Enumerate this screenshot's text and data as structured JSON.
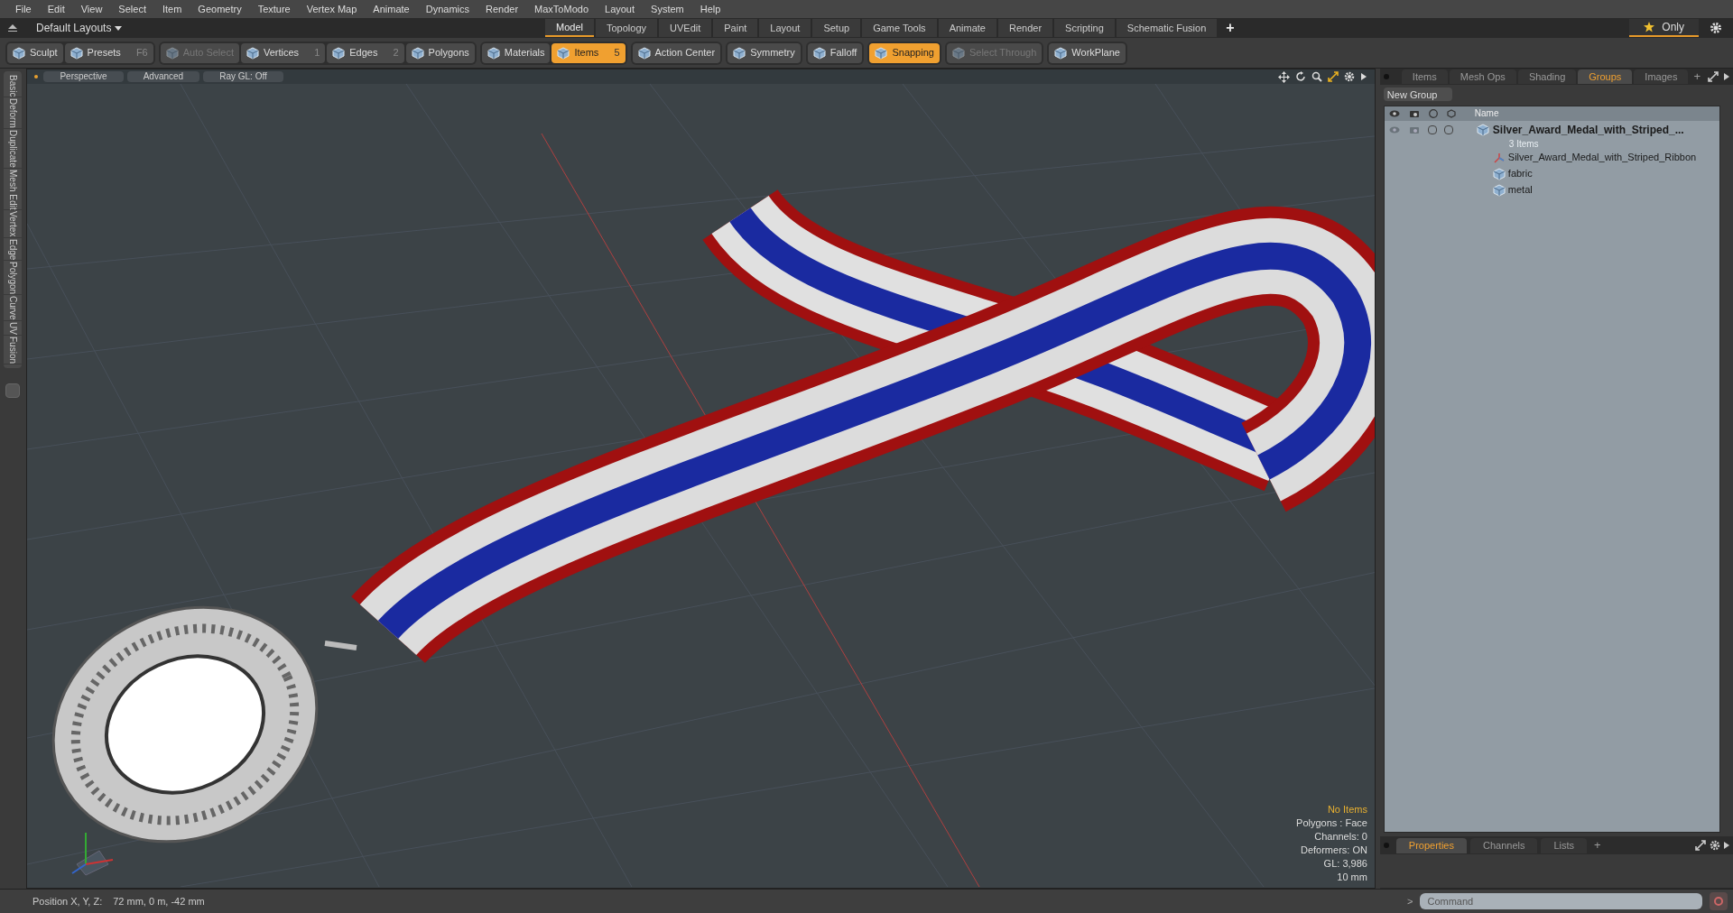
{
  "menu_bar": [
    "File",
    "Edit",
    "View",
    "Select",
    "Item",
    "Geometry",
    "Texture",
    "Vertex Map",
    "Animate",
    "Dynamics",
    "Render",
    "MaxToModo",
    "Layout",
    "System",
    "Help"
  ],
  "layout_selector": {
    "label": "Default Layouts"
  },
  "layout_tabs": [
    {
      "label": "Model",
      "selected": true
    },
    {
      "label": "Topology",
      "selected": false
    },
    {
      "label": "UVEdit",
      "selected": false
    },
    {
      "label": "Paint",
      "selected": false
    },
    {
      "label": "Layout",
      "selected": false
    },
    {
      "label": "Setup",
      "selected": false
    },
    {
      "label": "Game Tools",
      "selected": false
    },
    {
      "label": "Animate",
      "selected": false
    },
    {
      "label": "Render",
      "selected": false
    },
    {
      "label": "Scripting",
      "selected": false
    },
    {
      "label": "Schematic Fusion",
      "selected": false
    }
  ],
  "add_tab": {
    "label": "+"
  },
  "only_button": {
    "label": "Only"
  },
  "toolbar": [
    [
      {
        "label": "Sculpt",
        "selected": false,
        "disabled": false
      },
      {
        "label": "Presets",
        "shortcut": "F6",
        "selected": false,
        "disabled": false
      }
    ],
    [
      {
        "label": "Auto Select",
        "selected": false,
        "disabled": true
      },
      {
        "label": "Vertices",
        "shortcut": "1",
        "selected": false,
        "disabled": false
      },
      {
        "label": "Edges",
        "shortcut": "2",
        "selected": false,
        "disabled": false
      },
      {
        "label": "Polygons",
        "selected": false,
        "disabled": false
      }
    ],
    [
      {
        "label": "Materials",
        "selected": false,
        "disabled": false
      },
      {
        "label": "Items",
        "shortcut": "5",
        "selected": true,
        "disabled": false
      }
    ],
    [
      {
        "label": "Action Center",
        "selected": false,
        "disabled": false
      }
    ],
    [
      {
        "label": "Symmetry",
        "selected": false,
        "disabled": false
      }
    ],
    [
      {
        "label": "Falloff",
        "selected": false,
        "disabled": false
      }
    ],
    [
      {
        "label": "Snapping",
        "selected": true,
        "disabled": false
      }
    ],
    [
      {
        "label": "Select Through",
        "selected": false,
        "disabled": true
      }
    ],
    [
      {
        "label": "WorkPlane",
        "selected": false,
        "disabled": false
      }
    ]
  ],
  "side_tabs": [
    "Basic",
    "Deform",
    "Duplicate",
    "Mesh Edit",
    "Vertex",
    "Edge",
    "Polygon",
    "Curve",
    "UV",
    "Fusion"
  ],
  "viewport": {
    "header": [
      "Perspective",
      "Advanced",
      "Ray GL: Off"
    ],
    "info": [
      {
        "text": "No Items",
        "highlight": true
      },
      {
        "text": "Polygons : Face",
        "highlight": false
      },
      {
        "text": "Channels: 0",
        "highlight": false
      },
      {
        "text": "Deformers: ON",
        "highlight": false
      },
      {
        "text": "GL: 3,986",
        "highlight": false
      },
      {
        "text": "10 mm",
        "highlight": false
      }
    ]
  },
  "panel_tabs": [
    {
      "label": "Items",
      "selected": false
    },
    {
      "label": "Mesh Ops",
      "selected": false
    },
    {
      "label": "Shading",
      "selected": false
    },
    {
      "label": "Groups",
      "selected": true
    },
    {
      "label": "Images",
      "selected": false
    }
  ],
  "panel_add_tab": {
    "label": "+"
  },
  "new_group_button": {
    "label": "New Group"
  },
  "tree_header": {
    "name": "Name"
  },
  "tree": [
    {
      "label": "Silver_Award_Medal_with_Striped_...",
      "subtitle": "3 Items",
      "checks": [
        {
          "checked": false
        },
        {
          "checked": false
        }
      ],
      "children": [
        {
          "label": "Silver_Award_Medal_with_Striped_Ribbon",
          "kind": "locator"
        },
        {
          "label": "fabric",
          "kind": "mesh"
        },
        {
          "label": "metal",
          "kind": "mesh"
        }
      ]
    }
  ],
  "bottom_tabs": [
    {
      "label": "Properties",
      "selected": true
    },
    {
      "label": "Channels",
      "selected": false
    },
    {
      "label": "Lists",
      "selected": false
    }
  ],
  "bottom_add_tab": {
    "label": "+"
  },
  "command": {
    "prompt": ">",
    "placeholder": "Command"
  },
  "status_bar": {
    "label": "Position X, Y, Z:",
    "value": "72 mm, 0 m, -42 mm"
  }
}
